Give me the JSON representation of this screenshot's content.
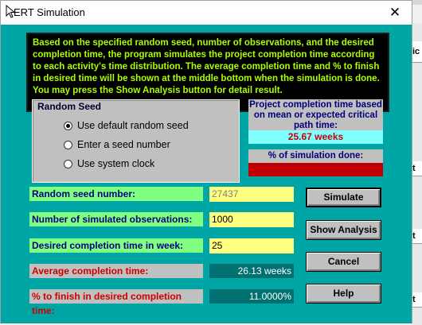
{
  "window": {
    "title": "ERT Simulation",
    "close_glyph": "✕"
  },
  "background": {
    "right_cells": [
      "ic t",
      "t",
      "t",
      "t"
    ]
  },
  "description": "Based on the specified random seed, number of observations, and the desired completion time, the program simulates the project completion time according to each activity's time distribution.  The average completion time and % to finish in desired time will be shown at the middle bottom when the simulation is done.  You may press the Show Analysis button for detail result.",
  "random_seed": {
    "title": "Random Seed",
    "options": [
      {
        "label": "Use default random seed",
        "selected": true
      },
      {
        "label": "Enter a seed number",
        "selected": false
      },
      {
        "label": "Use system clock",
        "selected": false
      }
    ]
  },
  "project_completion": {
    "heading": "Project completion time based on mean or expected critical path time:",
    "value": "25.67 weeks"
  },
  "simulation_progress": {
    "label": "% of simulation done:",
    "fraction": 1.0
  },
  "fields": {
    "seed_label": "Random seed number:",
    "seed_value": "27437",
    "observations_label": "Number of simulated observations:",
    "observations_value": "1000",
    "desired_label": "Desired completion time in week:",
    "desired_value": "25",
    "average_label": "Average completion time:",
    "average_value": "26.13 weeks",
    "percent_label": "% to finish in desired completion time:",
    "percent_value": "11.0000%"
  },
  "buttons": {
    "simulate": "Simulate",
    "show_analysis": "Show Analysis",
    "cancel": "Cancel",
    "help": "Help"
  },
  "colors": {
    "client_bg": "#00a6a6",
    "description_text": "#aaff00",
    "input_bg": "#ffff80",
    "output_bg": "#007070",
    "progress": "#c00000"
  }
}
